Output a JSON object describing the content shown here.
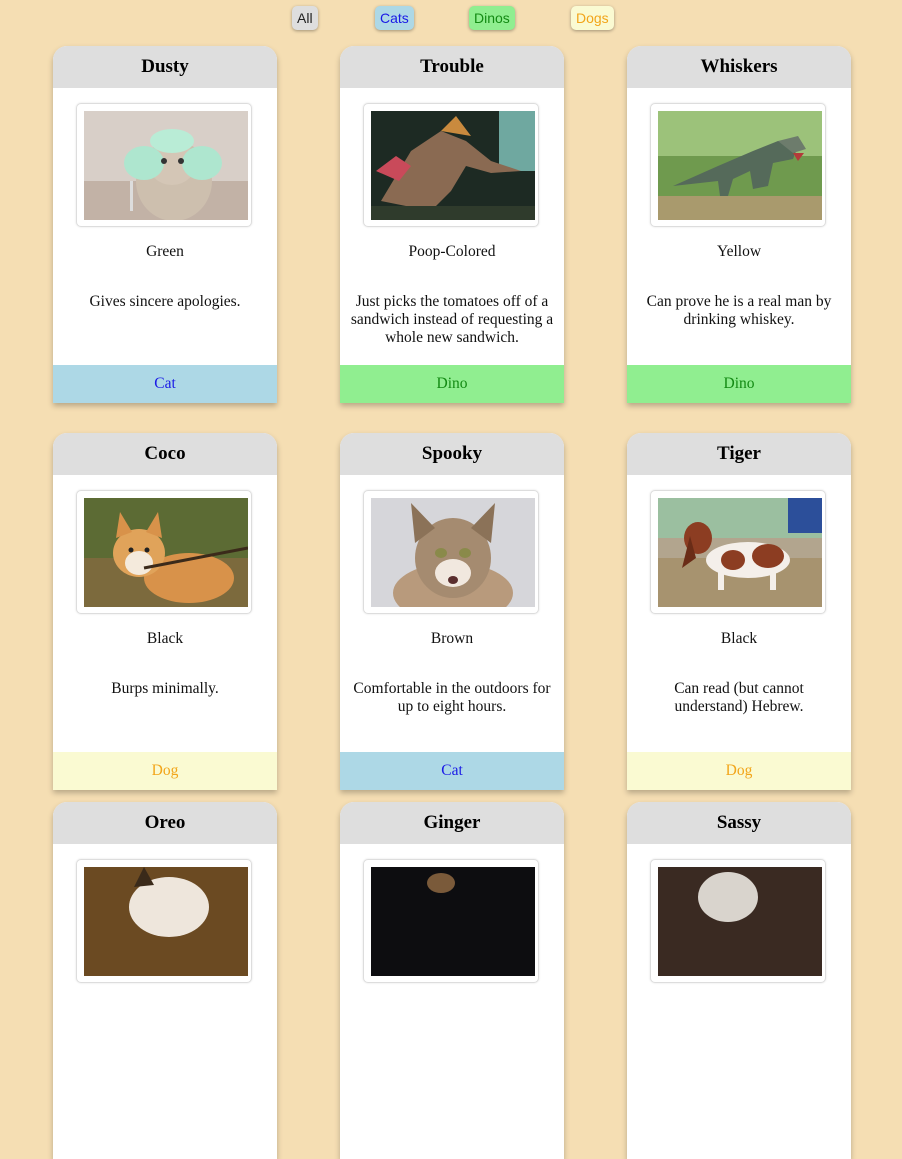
{
  "filters": {
    "all": "All",
    "cats": "Cats",
    "dinos": "Dinos",
    "dogs": "Dogs"
  },
  "cards": [
    {
      "name": "Dusty",
      "color": "Green",
      "description": "Gives sincere apologies.",
      "type": "Cat",
      "photo": "cat-with-green-headphones"
    },
    {
      "name": "Trouble",
      "color": "Poop-Colored",
      "description": "Just picks the tomatoes off of a sandwich instead of requesting a whole new sandwich.",
      "type": "Dino",
      "photo": "spinosaurus-exhibit"
    },
    {
      "name": "Whiskers",
      "color": "Yellow",
      "description": "Can prove he is a real man by drinking whiskey.",
      "type": "Dino",
      "photo": "t-rex-in-park"
    },
    {
      "name": "Coco",
      "color": "Black",
      "description": "Burps minimally.",
      "type": "Dog",
      "photo": "corgi-with-stick"
    },
    {
      "name": "Spooky",
      "color": "Brown",
      "description": "Comfortable in the outdoors for up to eight hours.",
      "type": "Cat",
      "photo": "maine-coon-cat"
    },
    {
      "name": "Tiger",
      "color": "Black",
      "description": "Can read (but cannot understand) Hebrew.",
      "type": "Dog",
      "photo": "basset-hound"
    },
    {
      "name": "Oreo",
      "color": "",
      "description": "",
      "type": "",
      "photo": "cat-photo"
    },
    {
      "name": "Ginger",
      "color": "",
      "description": "",
      "type": "",
      "photo": "dark-photo"
    },
    {
      "name": "Sassy",
      "color": "",
      "description": "",
      "type": "",
      "photo": "cat-photo"
    }
  ],
  "colors": {
    "page_background": "#f5deb3",
    "card_header": "#dedede",
    "cat_bar": "#add8e6",
    "cat_text": "#1a1ae6",
    "dino_bar": "#90ee90",
    "dino_text": "#138a13",
    "dog_bar": "#fafad2",
    "dog_text": "#f2a51a"
  }
}
